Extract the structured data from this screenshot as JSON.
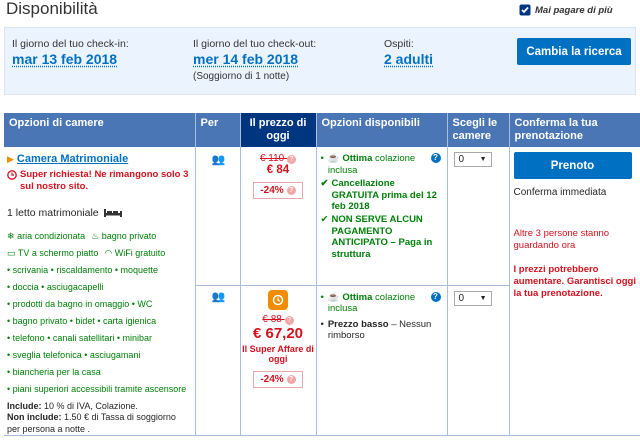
{
  "header": {
    "title": "Disponibilità",
    "never_pay_more": "Mai pagare di più"
  },
  "search": {
    "checkin_label": "Il giorno del tuo check-in:",
    "checkin_value": "mar 13 feb 2018",
    "checkout_label": "Il giorno del tuo check-out:",
    "checkout_value": "mer 14 feb 2018",
    "stay_note": "(Soggiorno di 1 notte)",
    "guests_label": "Ospiti:",
    "guests_value": "2 adulti",
    "change_button": "Cambia la ricerca"
  },
  "table": {
    "headers": [
      "Opzioni di camere",
      "Per",
      "Il prezzo di oggi",
      "Opzioni disponibili",
      "Scegli le camere",
      "Conferma la tua prenotazione"
    ]
  },
  "room": {
    "name": "Camera Matrimoniale",
    "alert": "Super richiesta! Ne rimangono solo 3 sul nostro sito.",
    "bed": "1 letto matrimoniale",
    "facilities_row1": [
      "aria condizionata",
      "bagno privato"
    ],
    "facilities_row2": [
      "TV a schermo piatto",
      "WiFi gratuito"
    ],
    "amenities": [
      [
        "scrivania",
        "riscaldamento",
        "moquette"
      ],
      [
        "doccia",
        "asciugacapelli"
      ],
      [
        "prodotti da bagno in omaggio",
        "WC"
      ],
      [
        "bagno privato",
        "bidet",
        "carta igienica"
      ],
      [
        "telefono",
        "canali satellitari",
        "minibar"
      ],
      [
        "sveglia telefonica",
        "asciugamani"
      ],
      [
        "biancheria per la casa"
      ],
      [
        "piani superiori accessibili tramite ascensore"
      ]
    ],
    "include_label": "Include:",
    "include_text": "10 % di IVA, Colazione.",
    "not_include_label": "Non include:",
    "not_include_text": "1.50 € di Tassa di soggiorno per persona a notte ."
  },
  "offer1": {
    "old_price": "€ 110",
    "price": "€ 84",
    "discount": "-24%",
    "breakfast_bold": "Ottima",
    "breakfast_rest": "colazione inclusa",
    "cancel": "Cancellazione GRATUITA prima del 12 feb 2018",
    "prepay": "NON SERVE ALCUN PAGAMENTO ANTICIPATO",
    "prepay_rest": "– Paga in struttura",
    "select_value": "0"
  },
  "offer2": {
    "old_price": "€ 88",
    "price": "€ 67,20",
    "deal": "Il Super Affare di oggi",
    "discount": "-24%",
    "breakfast_bold": "Ottima",
    "breakfast_rest": "colazione inclusa",
    "low_price_bold": "Prezzo basso",
    "low_price_rest": "– Nessun rimborso",
    "select_value": "0"
  },
  "confirm": {
    "button": "Prenoto",
    "immediate": "Conferma immediata",
    "watching": "Altre 3 persone stanno guardando ora",
    "warning": "I prezzi potrebbero aumentare. Garantisci oggi la tua prenotazione."
  },
  "colors": {
    "accent": "#0071c2",
    "header_blue": "#4b76b5",
    "price_header": "#003580",
    "alert_red": "#d4111e",
    "green": "#008009"
  }
}
